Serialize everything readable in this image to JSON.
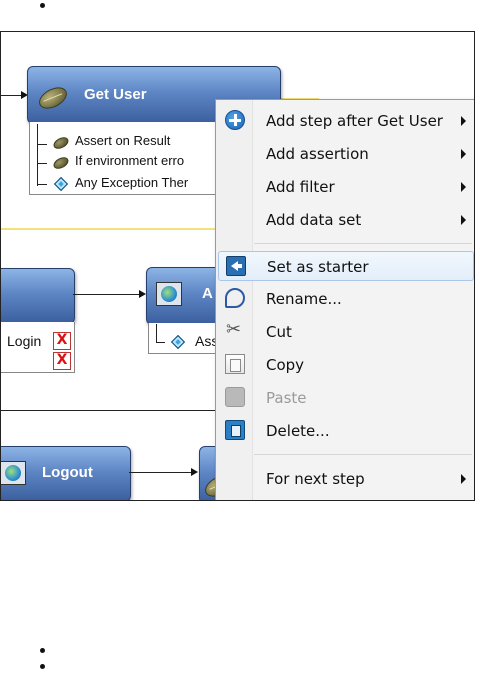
{
  "diagram": {
    "nodes": {
      "get_user": "Get User",
      "logout": "Logout",
      "a_node": "A"
    },
    "get_user_children": [
      {
        "label": "Assert on Result",
        "icon": "bean-icon"
      },
      {
        "label": "If environment erro",
        "icon": "bean-icon"
      },
      {
        "label": "Any Exception Ther",
        "icon": "diamond-icon"
      }
    ],
    "login_label": "Login",
    "a_child_label": "Ass"
  },
  "context_menu": {
    "items": [
      {
        "label": "Add step after Get User",
        "icon": "add-circle-icon",
        "submenu": true
      },
      {
        "label": "Add assertion",
        "submenu": true
      },
      {
        "label": "Add filter",
        "submenu": true
      },
      {
        "label": "Add data set",
        "submenu": true
      },
      {
        "label": "Set as starter",
        "icon": "set-starter-icon",
        "highlighted": true
      },
      {
        "label": "Rename...",
        "icon": "rename-icon"
      },
      {
        "label": "Cut",
        "icon": "scissors-icon"
      },
      {
        "label": "Copy",
        "icon": "copy-icon"
      },
      {
        "label": "Paste",
        "icon": "paste-icon",
        "disabled": true
      },
      {
        "label": "Delete...",
        "icon": "delete-icon"
      },
      {
        "label": "For next step",
        "submenu": true
      }
    ]
  },
  "colors": {
    "node_blue": "#5e86c4",
    "menu_bg": "#f3f3f3",
    "highlight": "#e3eefa"
  }
}
